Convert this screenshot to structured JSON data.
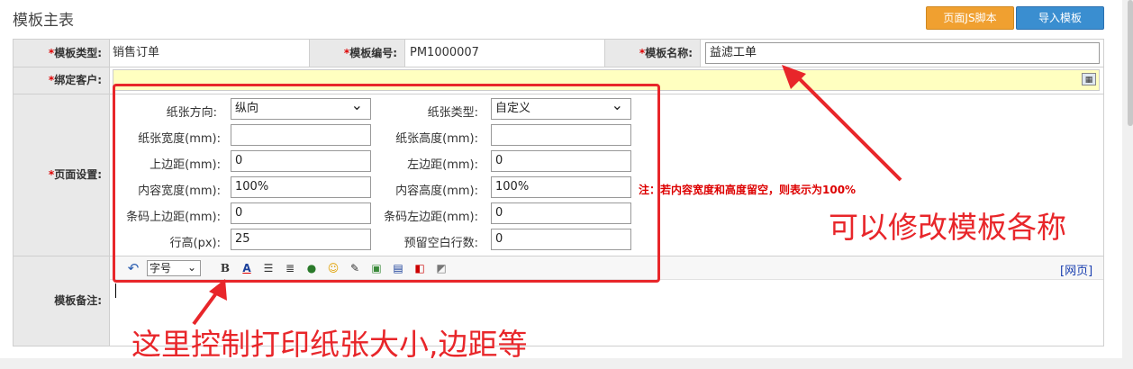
{
  "header": {
    "title": "模板主表",
    "js_button": "页面JS脚本",
    "import_button": "导入模板"
  },
  "row1": {
    "type_label": "模板类型:",
    "type_value": "销售订单",
    "code_label": "模板编号:",
    "code_value": "PM1000007",
    "name_label": "模板名称:",
    "name_value": "益滤工单"
  },
  "row2": {
    "customer_label": "绑定客户:",
    "customer_value": ""
  },
  "page_settings": {
    "label": "页面设置:",
    "orientation_label": "纸张方向:",
    "orientation_value": "纵向",
    "paper_type_label": "纸张类型:",
    "paper_type_value": "自定义",
    "paper_width_label": "纸张宽度(mm):",
    "paper_width_value": "",
    "paper_height_label": "纸张高度(mm):",
    "paper_height_value": "",
    "top_margin_label": "上边距(mm):",
    "top_margin_value": "0",
    "left_margin_label": "左边距(mm):",
    "left_margin_value": "0",
    "content_width_label": "内容宽度(mm):",
    "content_width_value": "100%",
    "content_height_label": "内容高度(mm):",
    "content_height_value": "100%",
    "note": "注：若内容宽度和高度留空，则表示为100%",
    "barcode_top_label": "条码上边距(mm):",
    "barcode_top_value": "0",
    "barcode_left_label": "条码左边距(mm):",
    "barcode_left_value": "0",
    "row_height_label": "行高(px):",
    "row_height_value": "25",
    "blank_rows_label": "预留空白行数:",
    "blank_rows_value": "0"
  },
  "remark": {
    "label": "模板备注:",
    "font_size_select": "字号",
    "web_link": "[网页]"
  },
  "annotations": {
    "rename": "可以修改模板各称",
    "print": "这里控制打印纸张大小,边距等"
  }
}
